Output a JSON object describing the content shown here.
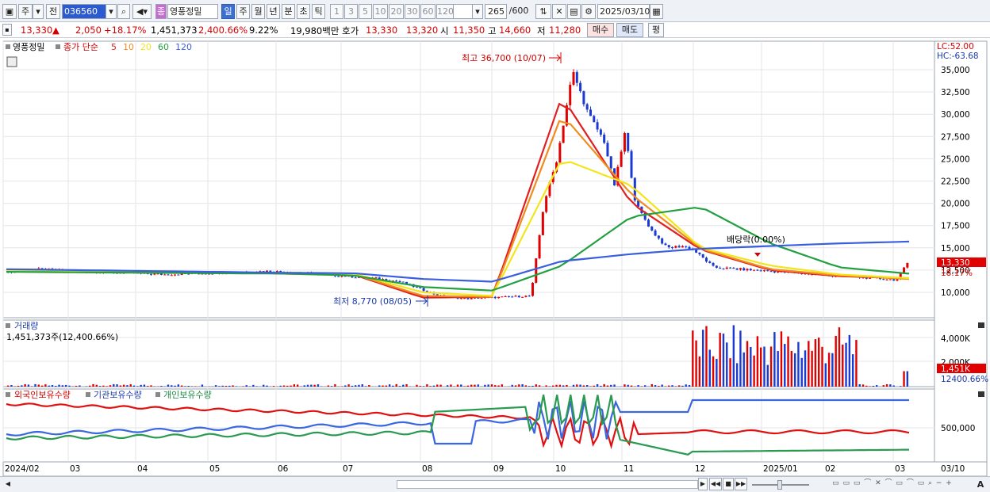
{
  "toolbar": {
    "market_btn": "주",
    "prev_btn": "전",
    "code": "036560",
    "stock_badge": "종",
    "stock_name": "영풍정밀",
    "periods": [
      "일",
      "주",
      "월",
      "년",
      "분",
      "초",
      "틱"
    ],
    "selected_period": "일",
    "intervals": [
      "1",
      "3",
      "5",
      "10",
      "20",
      "30",
      "60",
      "120"
    ],
    "count": "265",
    "count_max": "/600",
    "date": "2025/03/10"
  },
  "quote": {
    "price": "13,330",
    "arrow": "▲",
    "change": "2,050",
    "change_pct": "+18.17%",
    "volume": "1,451,373",
    "volume_pct": "2,400.66%",
    "turnover_pct": "9.22%",
    "amount": "19,980백만",
    "hoga_label": "호가",
    "ask": "13,330",
    "bid": "13,320",
    "open_label": "시",
    "open": "11,350",
    "high_label": "고",
    "high": "14,660",
    "low_label": "저",
    "low": "11,280",
    "buy_btn": "매수",
    "sell_btn": "매도",
    "eval_btn": "평"
  },
  "price_panel": {
    "legend_name": "영풍정밀",
    "legend_ma": "종가 단순",
    "ma_periods": [
      "5",
      "10",
      "20",
      "60",
      "120"
    ],
    "lc": "LC:52.00",
    "hc": "HC:-63.68",
    "high_note": "최고 36,700 (10/07)",
    "low_note": "최저 8,770 (08/05)",
    "dividend_note": "배당락(0.00%)",
    "last_price_tag": "13,330",
    "last_pct_tag": "18.17%",
    "y_ticks": [
      "35,000",
      "32,500",
      "30,000",
      "27,500",
      "25,000",
      "22,500",
      "20,000",
      "17,500",
      "15,000",
      "12,500",
      "10,000"
    ]
  },
  "volume_panel": {
    "title": "거래량",
    "value": "1,451,373주(12,400.66%)",
    "y_ticks": [
      "4,000K",
      "2,000K"
    ],
    "last_tag": "1,451K",
    "last_pct": "12400.66%"
  },
  "holding_panel": {
    "legend": [
      "외국인보유수량",
      "기관보유수량",
      "개인보유수량"
    ],
    "y_tick": "500,000"
  },
  "x_axis": [
    "2024/02",
    "03",
    "04",
    "05",
    "06",
    "07",
    "08",
    "09",
    "10",
    "11",
    "12",
    "2025/01",
    "02",
    "03",
    "03/10"
  ],
  "colors": {
    "up": "#e00000",
    "down": "#1a3ad0",
    "ma5": "#e02020",
    "ma10": "#f08c1e",
    "ma20": "#f2e61a",
    "ma60": "#22a040",
    "ma120": "#3a5ee0",
    "foreign": "#e01010",
    "inst": "#3a66e0",
    "indiv": "#2a9a50"
  },
  "chart_data": {
    "type": "line",
    "x": [
      "2024/02",
      "03",
      "04",
      "05",
      "06",
      "07",
      "08",
      "09",
      "10",
      "11",
      "12",
      "2025/01",
      "02",
      "03"
    ],
    "series": [
      {
        "name": "5",
        "values": [
          12500,
          12400,
          12200,
          12300,
          12100,
          12000,
          9400,
          9500,
          32000,
          20000,
          14800,
          12500,
          11800,
          11600
        ]
      },
      {
        "name": "10",
        "values": [
          12500,
          12400,
          12250,
          12300,
          12150,
          12050,
          9600,
          9500,
          30000,
          21000,
          14900,
          12600,
          11900,
          11500
        ]
      },
      {
        "name": "20",
        "values": [
          12400,
          12350,
          12300,
          12250,
          12200,
          12100,
          10000,
          9600,
          25000,
          22000,
          15000,
          13000,
          12000,
          11600
        ]
      },
      {
        "name": "60",
        "values": [
          12300,
          12250,
          12200,
          12150,
          12100,
          11900,
          10600,
          10200,
          13000,
          18500,
          19600,
          15500,
          12800,
          12100
        ]
      },
      {
        "name": "120",
        "values": [
          12600,
          12500,
          12400,
          12300,
          12200,
          12150,
          11500,
          11200,
          13500,
          14300,
          14900,
          15200,
          15500,
          15700
        ]
      }
    ],
    "ylim": [
      8000,
      36500
    ]
  }
}
